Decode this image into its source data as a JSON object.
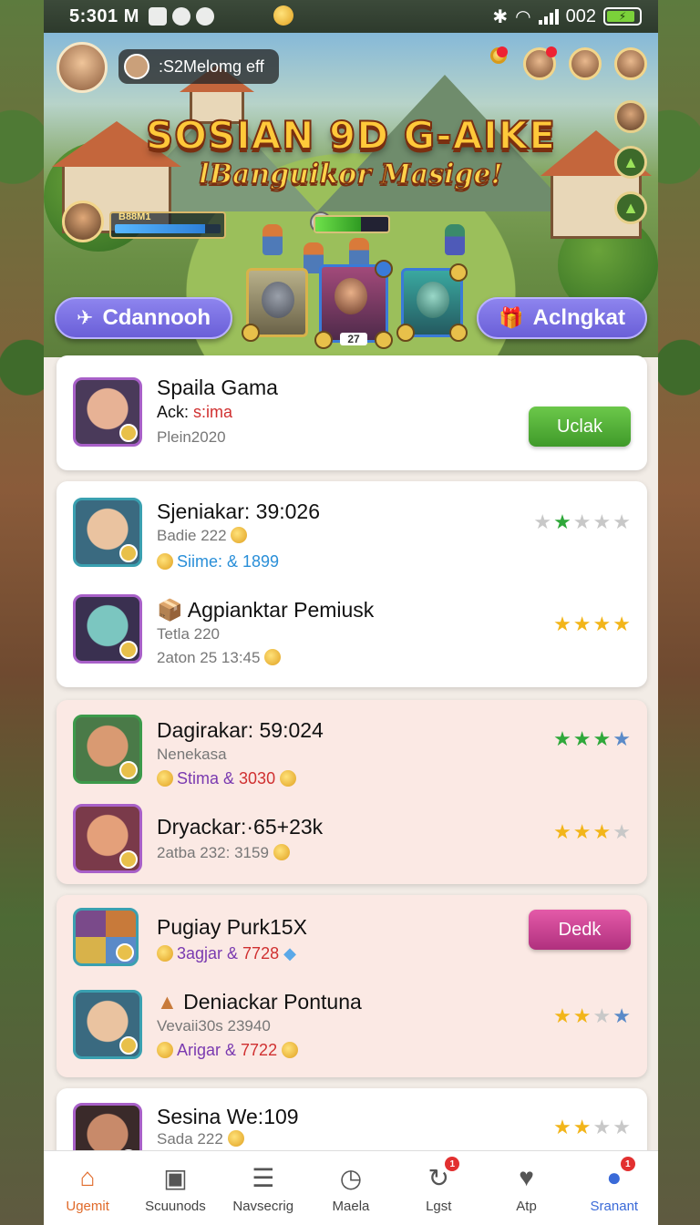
{
  "status_bar": {
    "time": "5:301 M",
    "battery": "002"
  },
  "hero": {
    "player_name": ":S2Melomg eff",
    "title": "SOSIAN 9D G-AIKE",
    "subtitle": "lBanguikor Masige!",
    "hud_label": "B88M1",
    "card_number": "27",
    "left_button": "Cdannooh",
    "right_button": "Aclngkat"
  },
  "cards": [
    {
      "rows": [
        {
          "title": "Spaila Gama",
          "line2_prefix": "Ack: ",
          "line2_accent": "s:ima",
          "line3": "Plein2020",
          "action": "Uclak"
        }
      ]
    },
    {
      "rows": [
        {
          "title": "Sjeniakar: 39:026",
          "line2": "Badie 222",
          "line3": "Siime: & 1899",
          "stars": [
            "off",
            "green",
            "off",
            "off",
            "off"
          ]
        },
        {
          "title": "Agpianktar Pemiusk",
          "line2": "Tetla 220",
          "line3_prefix": "2aton 25 ",
          "line3_accent": "13:45",
          "stars": [
            "gold",
            "gold",
            "gold",
            "gold"
          ]
        }
      ]
    },
    {
      "rows": [
        {
          "title": "Dagirakar: 59:024",
          "line2": "Nenekasa",
          "line3_prefix": "Stima & ",
          "line3_accent": "3030",
          "stars": [
            "green",
            "green",
            "green",
            "blue"
          ]
        },
        {
          "title": "Dryackar:·65+23k",
          "line2_prefix": "2atba 232: ",
          "line2_accent": "3159",
          "stars": [
            "gold",
            "gold",
            "gold",
            "off"
          ]
        }
      ]
    },
    {
      "rows": [
        {
          "title": "Pugiay Purk15X",
          "line2_prefix": "3agjar & ",
          "line2_accent": "7728",
          "action": "Dedk"
        },
        {
          "title": "Deniackar Pontuna",
          "line2_prefix": "Vevaii30s ",
          "line2_accent": "23940",
          "line3_prefix": "Arigar & ",
          "line3_accent": "7722",
          "stars": [
            "gold",
            "gold",
            "off",
            "blue"
          ]
        }
      ]
    },
    {
      "rows": [
        {
          "title": "Sesina We:109",
          "line2": "Sada 222",
          "stars": [
            "gold",
            "gold",
            "off",
            "off"
          ]
        }
      ]
    }
  ],
  "nav": [
    {
      "label": "Ugemit",
      "icon": "home-icon"
    },
    {
      "label": "Scuunods",
      "icon": "controller-icon"
    },
    {
      "label": "Navsecrig",
      "icon": "list-icon"
    },
    {
      "label": "Maela",
      "icon": "clock-icon"
    },
    {
      "label": "Lgst",
      "icon": "refresh-icon",
      "badge": "1"
    },
    {
      "label": "Atp",
      "icon": "location-icon"
    },
    {
      "label": "Sranant",
      "icon": "profile-icon",
      "badge": "1"
    }
  ],
  "colors": {
    "accent_orange": "#e06a2a",
    "button_purple": "#6a5fd8",
    "button_green": "#3f9a2a",
    "button_pink": "#b0307e",
    "card_pink": "#fbe9e4"
  }
}
